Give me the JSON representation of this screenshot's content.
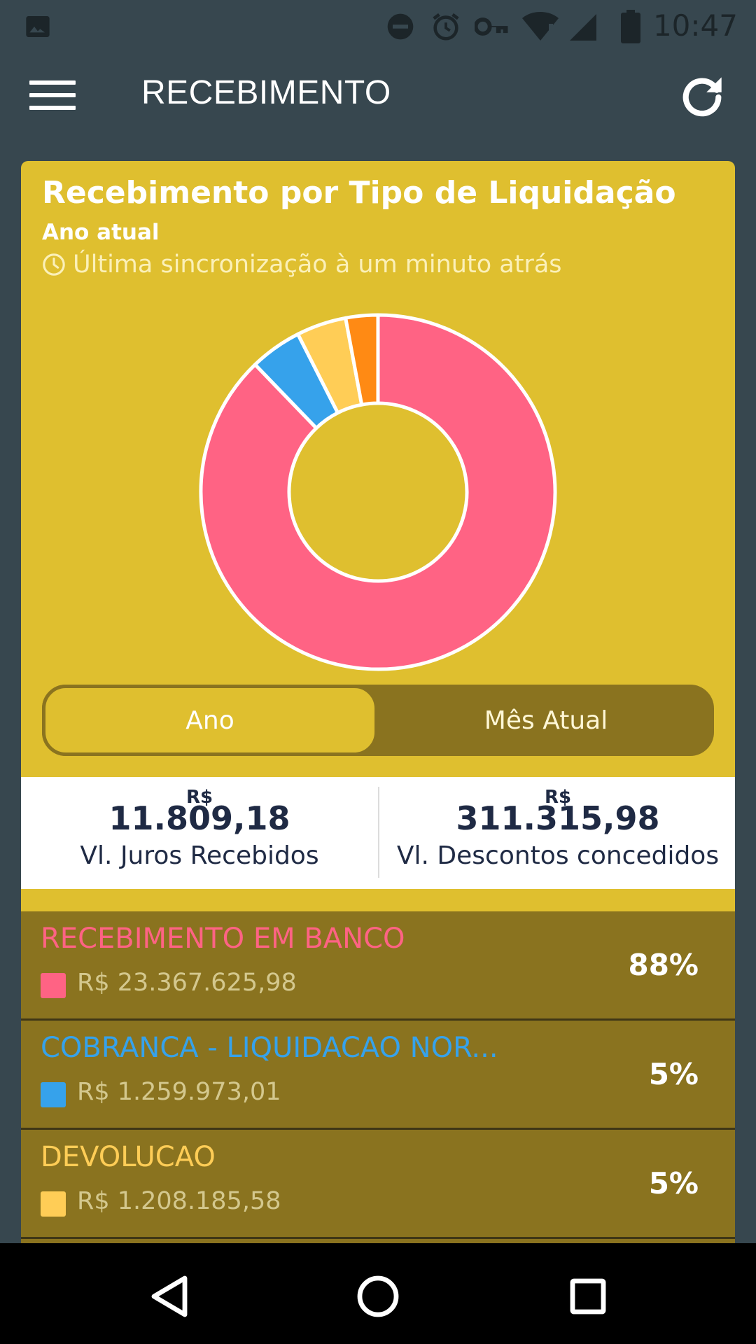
{
  "status_bar": {
    "time": "10:47",
    "icons": [
      "image-icon",
      "do-not-disturb-icon",
      "alarm-icon",
      "vpn-key-icon",
      "wifi-icon",
      "signal-icon",
      "battery-icon"
    ]
  },
  "app_bar": {
    "title": "RECEBIMENTO",
    "menu_icon": "hamburger-menu-icon",
    "refresh_icon": "refresh-icon"
  },
  "card": {
    "title": "Recebimento por Tipo de Liquidação",
    "period": "Ano atual",
    "sync_text": "Última sincronização à um minuto atrás",
    "toggle": {
      "active": "Ano",
      "inactive": "Mês Atual"
    },
    "juros": {
      "currency": "R$",
      "amount": "11.809,18",
      "label": "Vl. Juros Recebidos"
    },
    "descontos": {
      "currency": "R$",
      "amount": "311.315,98",
      "label": "Vl. Descontos concedidos"
    }
  },
  "chart_data": {
    "type": "pie",
    "donut": true,
    "slices": [
      {
        "label": "RECEBIMENTO EM BANCO",
        "value": 23367625.98,
        "color": "#ff6384"
      },
      {
        "label": "COBRANCA - LIQUIDACAO NOR...",
        "value": 1259973.01,
        "color": "#36a2eb"
      },
      {
        "label": "DEVOLUCAO",
        "value": 1208185.58,
        "color": "#ffcd56"
      },
      {
        "value": 780000,
        "color": "#ff8a14"
      }
    ]
  },
  "list": [
    {
      "name": "RECEBIMENTO EM BANCO",
      "value": "R$ 23.367.625,98",
      "percent": "88%",
      "color": "#ff6384"
    },
    {
      "name": "COBRANCA - LIQUIDACAO NOR...",
      "value": "R$ 1.259.973,01",
      "percent": "5%",
      "color": "#36a2eb"
    },
    {
      "name": "DEVOLUCAO",
      "value": "R$ 1.208.185,58",
      "percent": "5%",
      "color": "#ffcd56"
    }
  ],
  "nav_bar": {
    "icons": [
      "back-icon",
      "home-icon",
      "recents-icon"
    ]
  }
}
